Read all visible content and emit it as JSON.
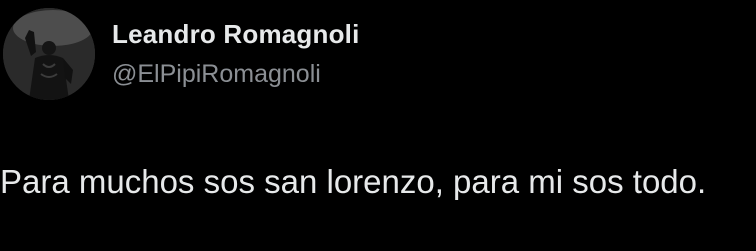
{
  "tweet": {
    "author": {
      "display_name": "Leandro Romagnoli",
      "handle": "@ElPipiRomagnoli",
      "avatar_icon": "player-photo"
    },
    "text": "Para muchos sos san lorenzo, para mi sos todo."
  },
  "colors": {
    "background": "#000000",
    "primary_text": "#e7e9ea",
    "secondary_text": "#8b8f94"
  }
}
